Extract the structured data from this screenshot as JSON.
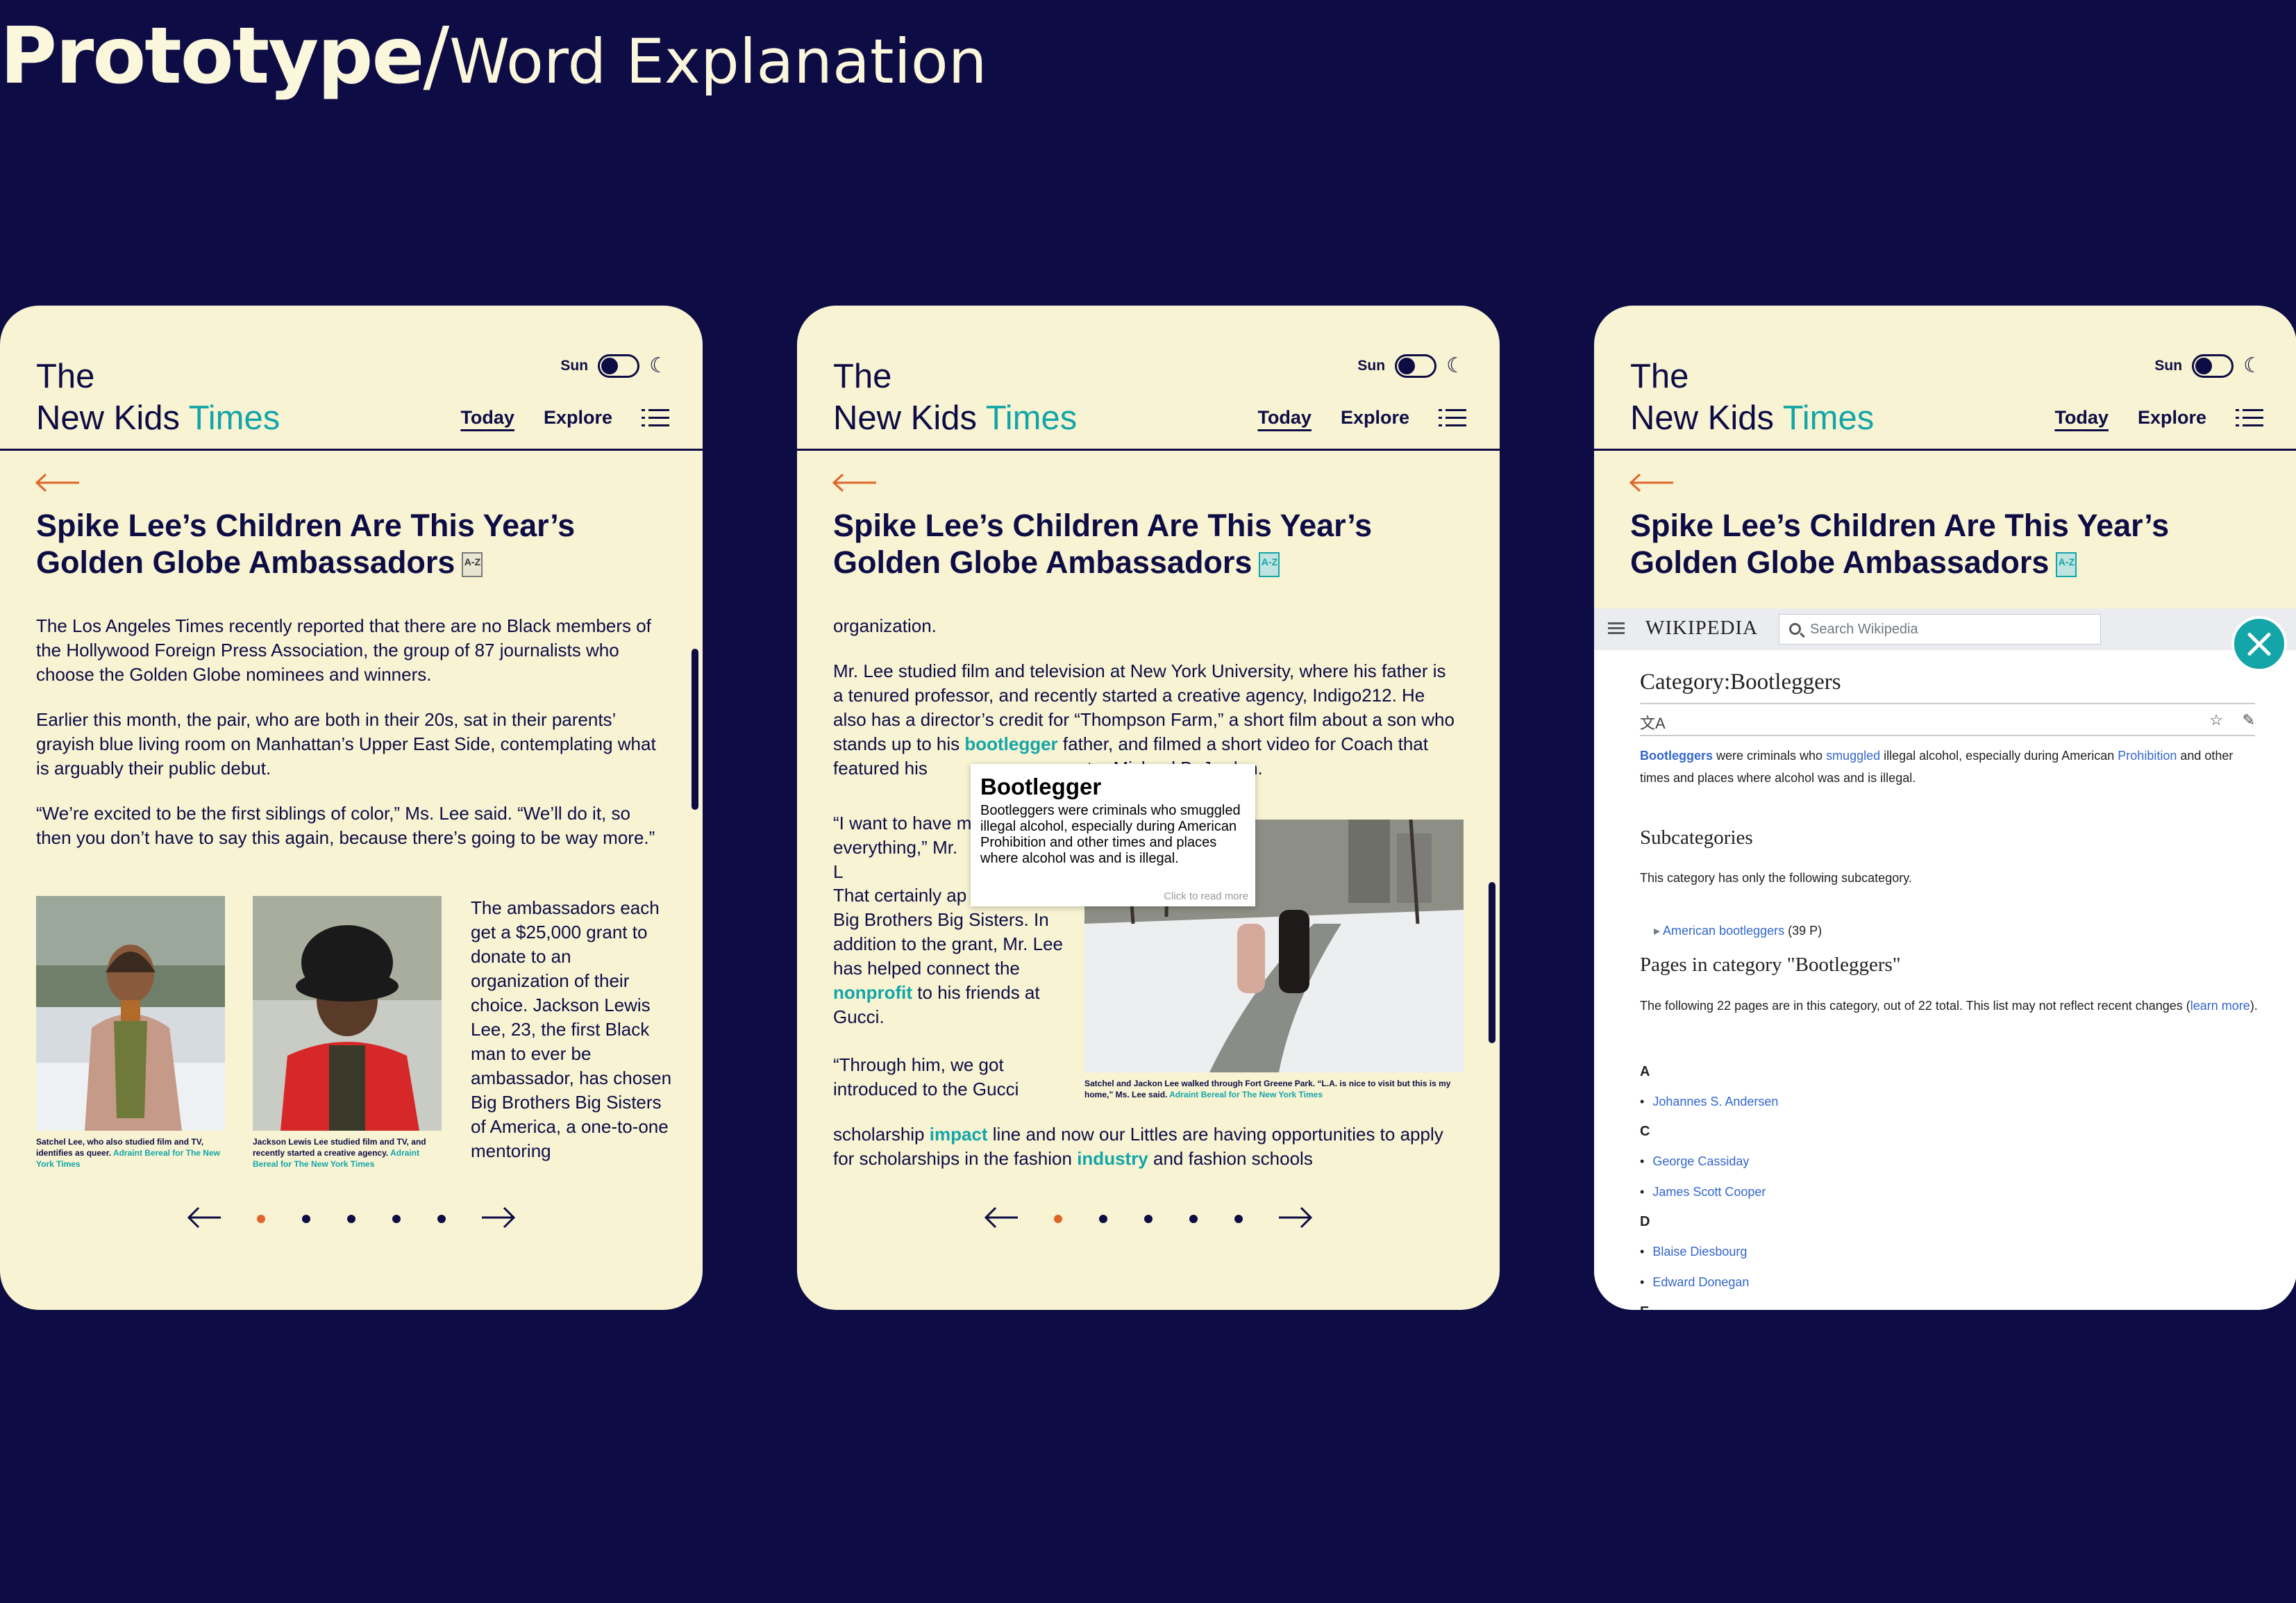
{
  "slide": {
    "title_bold": "Prototype",
    "title_slash": "/",
    "title_light": "Word Explanation"
  },
  "app": {
    "brand_line1": "The",
    "brand_line2_a": "New Kids ",
    "brand_line2_b": "Times",
    "theme_label": "Sun",
    "nav_today": "Today",
    "nav_explore": "Explore",
    "headline": "Spike Lee’s Children Are This Year’s Golden Globe Ambassadors",
    "dictionary_icon": "A-Z",
    "colors": {
      "background": "#0e0c45",
      "panel": "#f7f3d3",
      "accent": "#14a5a8",
      "highlight": "#e0652a"
    }
  },
  "panel1": {
    "p1": "The Los Angeles Times recently reported that there are no Black members of the Hollywood Foreign Press Association, the group of 87 journalists who choose the Golden Globe nominees and winners.",
    "p2": "Earlier this month, the pair, who are both in their 20s, sat in their parents’ grayish blue living room on Manhattan’s Upper East Side, contemplating what is arguably their public debut.",
    "p3": "“We’re excited to be the first siblings of color,” Ms. Lee said. “We’ll do it, so then you don’t have to say this again, because there’s going to be way more.”",
    "cap1": "Satchel Lee, who also studied film and TV, identifies as queer.",
    "cap1_credit": "Adraint Bereal for The New York Times",
    "cap2": "Jackson Lewis Lee studied film and TV, and recently started a creative agency.",
    "cap2_credit": "Adraint Bereal for The New York Times",
    "side": "The ambassadors each get a $25,000 grant to donate to an organization of their choice. Jackson Lewis Lee, 23, the first Black man to ever be ambassador, has chosen Big Brothers Big Sisters of America, a one-to-one mentoring"
  },
  "panel2": {
    "p1": "organization.",
    "p2a": "Mr. Lee studied film and television at New York University, where his father is a tenured professor, and recently started a creative agency, Indigo212. He also has a director’s credit for “Thompson Farm,” a short film about a son who stands up to his ",
    "p2_link": "bootlegger",
    "p2b": " father, and filmed a short video for Coach that featured his",
    "p2_tail": "tor Michael B. Jordan.",
    "p3a": "“I want to have m",
    "p3b": "everything,” Mr. L",
    "p4a": "That certainly ap",
    "p4b": "Big Brothers Big Sisters. In addition to the grant, Mr. Lee has helped connect the ",
    "p4_link": "nonprofit",
    "p4c": " to his friends at Gucci.",
    "p5": "“Through him, we got introduced to the Gucci",
    "p6a": "scholarship ",
    "p6_link1": "impact",
    "p6b": " line and now our Littles are having opportunities to apply for scholarships in the fashion ",
    "p6_link2": "industry",
    "p6c": " and fashion schools",
    "caption": "Satchel and Jackon Lee walked through Fort Greene Park. “L.A. is nice to visit but this is my home,” Ms. Lee said.",
    "caption_credit": "Adraint Bereal for The New York Times",
    "popup_title": "Bootlegger",
    "popup_body": "Bootleggers were criminals who smuggled illegal alcohol, especially during American Prohibition and other times and places where alcohol was and is illegal.",
    "popup_more": "Click to read more"
  },
  "panel3": {
    "wiki_logo": "WIKIPEDIA",
    "search_placeholder": "Search Wikipedia",
    "page_title": "Category:Bootleggers",
    "intro_link1": "Bootleggers",
    "intro_a": " were criminals who ",
    "intro_link2": "smuggled",
    "intro_b": " illegal alcohol, especially during American ",
    "intro_link3": "Prohibition",
    "intro_c": " and other times and places where alcohol was and is illegal.",
    "subcategories_heading": "Subcategories",
    "subcategories_text": "This category has only the following subcategory.",
    "subcat_link": "American bootleggers",
    "subcat_count": " (39 P)",
    "pages_heading": "Pages in category \"Bootleggers\"",
    "pages_text_a": "The following 22 pages are in this category, out of 22 total. This list may not reflect recent changes (",
    "pages_text_link": "learn more",
    "pages_text_b": ").",
    "letters": [
      "A",
      "C",
      "D",
      "E"
    ],
    "entries_a": [
      "Johannes S. Andersen"
    ],
    "entries_c": [
      "George Cassiday",
      "James Scott Cooper"
    ],
    "entries_d": [
      "Blaise Diesbourg",
      "Edward Donegan"
    ]
  },
  "pager": {
    "count": 5,
    "active": 0
  }
}
